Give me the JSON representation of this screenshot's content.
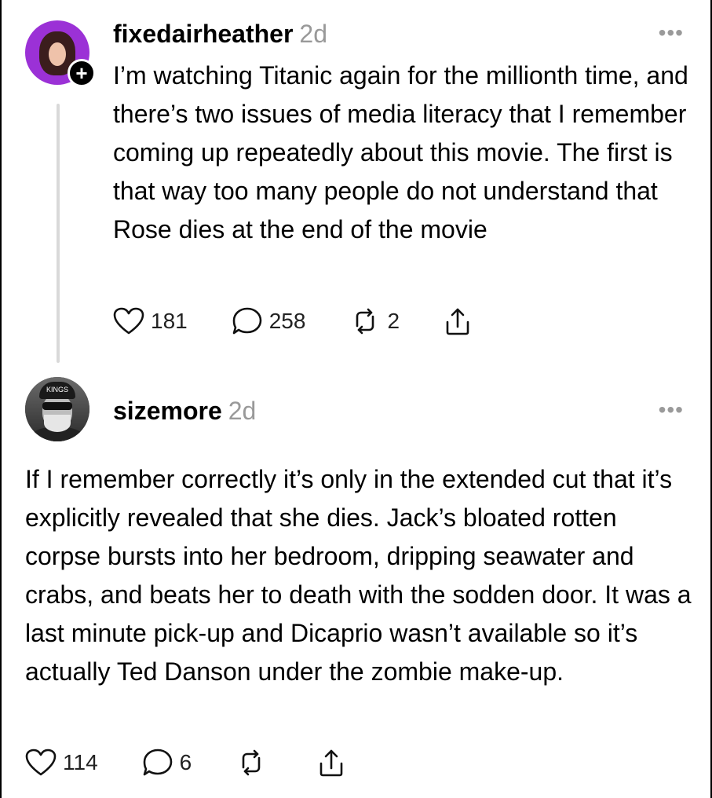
{
  "posts": [
    {
      "username": "fixedairheather",
      "time": "2d",
      "text": "I’m watching Titanic again for the millionth time, and there’s two issues of media literacy that I remember coming up repeatedly about this movie. The first is that way too many people do not understand that Rose dies at the end of the movie",
      "likes": "181",
      "replies": "258",
      "reposts": "2",
      "follow_badge": "+",
      "more": "•••"
    },
    {
      "username": "sizemore",
      "time": "2d",
      "text": "If I remember correctly it’s only in the extended cut that it’s explicitly revealed that she dies. Jack’s bloated rotten corpse bursts into her bedroom, dripping seawater and crabs, and beats her to death with the sodden door. It was a last minute pick-up and Dicaprio wasn’t available so it’s actually Ted Danson under the zombie make-up.",
      "likes": "114",
      "replies": "6",
      "reposts": "",
      "avatar_cap_text": "KINGS",
      "more": "•••"
    }
  ],
  "icons": {
    "like": "heart-icon",
    "reply": "comment-icon",
    "repost": "repost-icon",
    "share": "share-icon",
    "more": "more-options-icon"
  }
}
